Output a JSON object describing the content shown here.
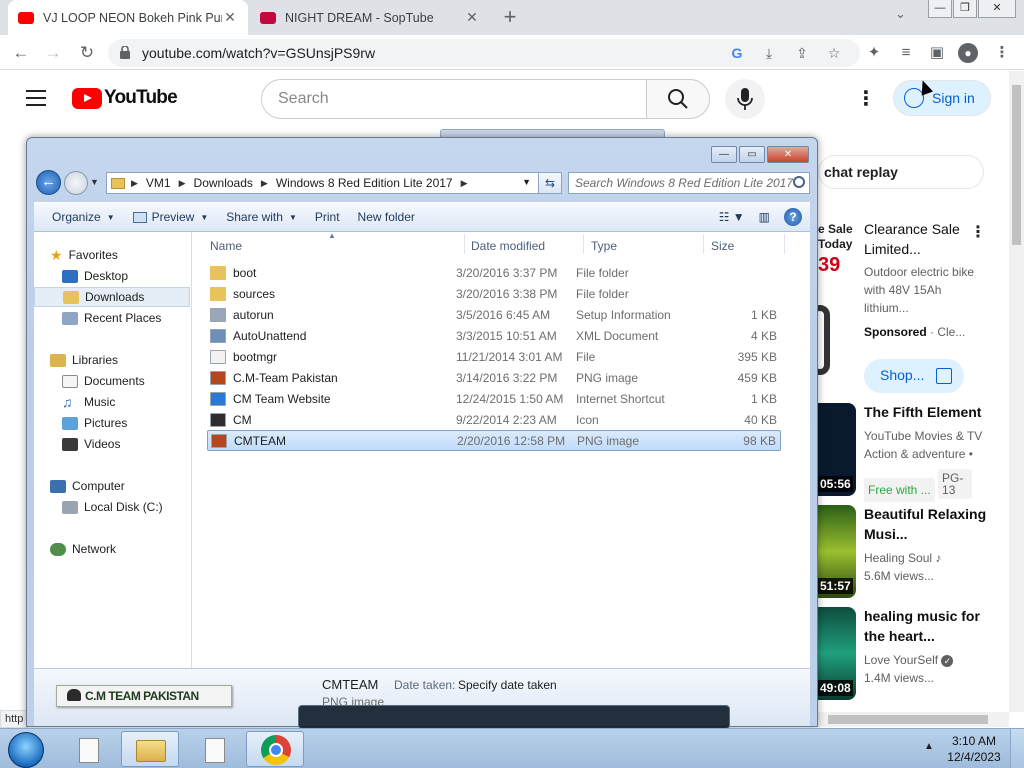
{
  "browser": {
    "tabs": [
      {
        "title": "VJ LOOP NEON Bokeh Pink Purpl",
        "favicon_color": "#ff0000",
        "active": true
      },
      {
        "title": "NIGHT DREAM - SopTube",
        "favicon_color": "#c3073f",
        "active": false
      }
    ],
    "new_tab": "+",
    "url": "youtube.com/watch?v=GSUnsjPS9rw"
  },
  "youtube": {
    "logo": "YouTube",
    "search_placeholder": "Search",
    "sign_in": "Sign in",
    "chat_replay": "chat replay",
    "ad": {
      "thumb_line1": "e Sale",
      "thumb_line2": "Today",
      "thumb_price": "39",
      "title": "Clearance Sale Limited...",
      "desc": "Outdoor electric bike with 48V 15Ah lithium...",
      "sponsored": "Sponsored",
      "advertiser": "Cle...",
      "shop": "Shop..."
    },
    "videos": [
      {
        "title": "The Fifth Element",
        "channel": "YouTube Movies & TV",
        "meta": "Action & adventure •",
        "badge": "Free with ...",
        "rating": "PG-13",
        "duration": "05:56",
        "thumb_color": "#0a1a2e"
      },
      {
        "title": "Beautiful Relaxing Musi...",
        "channel": "Healing Soul",
        "meta": "5.6M views...",
        "duration": "51:57",
        "thumb_color": "#3d6b1c"
      },
      {
        "title": "healing music for the heart...",
        "channel": "Love YourSelf",
        "meta": "1.4M views...",
        "duration": "49:08",
        "thumb_color": "#0f5e4a"
      }
    ],
    "status_url": "http"
  },
  "explorer": {
    "address": [
      "VM1",
      "Downloads",
      "Windows 8 Red Edition Lite 2017"
    ],
    "search_placeholder": "Search Windows 8 Red Edition Lite 2017",
    "commands": [
      "Organize",
      "Preview",
      "Share with",
      "Print",
      "New folder"
    ],
    "nav": {
      "favorites": "Favorites",
      "desktop": "Desktop",
      "downloads": "Downloads",
      "recent": "Recent Places",
      "libraries": "Libraries",
      "documents": "Documents",
      "music": "Music",
      "pictures": "Pictures",
      "videos": "Videos",
      "computer": "Computer",
      "local_disk": "Local Disk (C:)",
      "network": "Network"
    },
    "columns": [
      "Name",
      "Date modified",
      "Type",
      "Size"
    ],
    "files": [
      {
        "name": "boot",
        "date": "3/20/2016 3:37 PM",
        "type": "File folder",
        "size": "",
        "icon_color": "#e8c25a"
      },
      {
        "name": "sources",
        "date": "3/20/2016 3:38 PM",
        "type": "File folder",
        "size": "",
        "icon_color": "#e8c25a"
      },
      {
        "name": "autorun",
        "date": "3/5/2016 6:45 AM",
        "type": "Setup Information",
        "size": "1 KB",
        "icon_color": "#9aa7b8"
      },
      {
        "name": "AutoUnattend",
        "date": "3/3/2015 10:51 AM",
        "type": "XML Document",
        "size": "4 KB",
        "icon_color": "#6f8fb9"
      },
      {
        "name": "bootmgr",
        "date": "11/21/2014 3:01 AM",
        "type": "File",
        "size": "395 KB",
        "icon_color": "#f2f2f2"
      },
      {
        "name": "C.M-Team Pakistan",
        "date": "3/14/2016 3:22 PM",
        "type": "PNG image",
        "size": "459 KB",
        "icon_color": "#b5471e"
      },
      {
        "name": "CM Team Website",
        "date": "12/24/2015 1:50 AM",
        "type": "Internet Shortcut",
        "size": "1 KB",
        "icon_color": "#2a7ad5"
      },
      {
        "name": "CM",
        "date": "9/22/2014 2:23 AM",
        "type": "Icon",
        "size": "40 KB",
        "icon_color": "#2d2d2d"
      },
      {
        "name": "CMTEAM",
        "date": "2/20/2016 12:58 PM",
        "type": "PNG image",
        "size": "98 KB",
        "icon_color": "#b5471e",
        "selected": true
      }
    ],
    "details": {
      "logo_text": "C.M TEAM PAKISTAN",
      "name": "CMTEAM",
      "type": "PNG image",
      "label": "Date taken:",
      "value": "Specify date taken"
    }
  },
  "taskbar": {
    "time": "3:10 AM",
    "date": "12/4/2023"
  }
}
